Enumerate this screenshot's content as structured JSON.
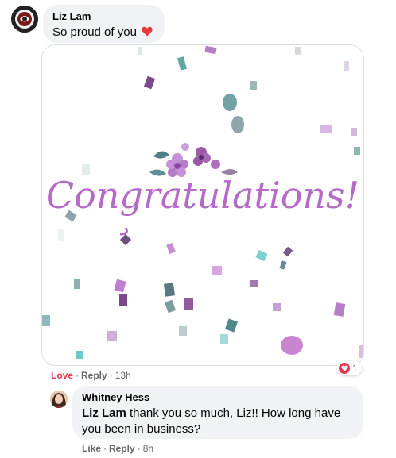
{
  "comments": [
    {
      "author": "Liz Lam",
      "text": "So proud of you",
      "emoji": "❤️",
      "gif": {
        "text": "Congratulations!"
      },
      "actions": {
        "love": "Love",
        "reply": "Reply",
        "time": "13h"
      },
      "reactions": {
        "count": "1",
        "icon": "heart-icon"
      }
    },
    {
      "author": "Whitney Hess",
      "mention": "Liz Lam",
      "text": " thank you so much, Liz!! How long have you been in business?",
      "actions": {
        "like": "Like",
        "reply": "Reply",
        "time": "8h"
      }
    }
  ],
  "colors": {
    "bubble": "#f0f2f5",
    "meta": "#65676b",
    "love": "#e4374f",
    "gif_text": "#b56ac8"
  },
  "separator": "·"
}
